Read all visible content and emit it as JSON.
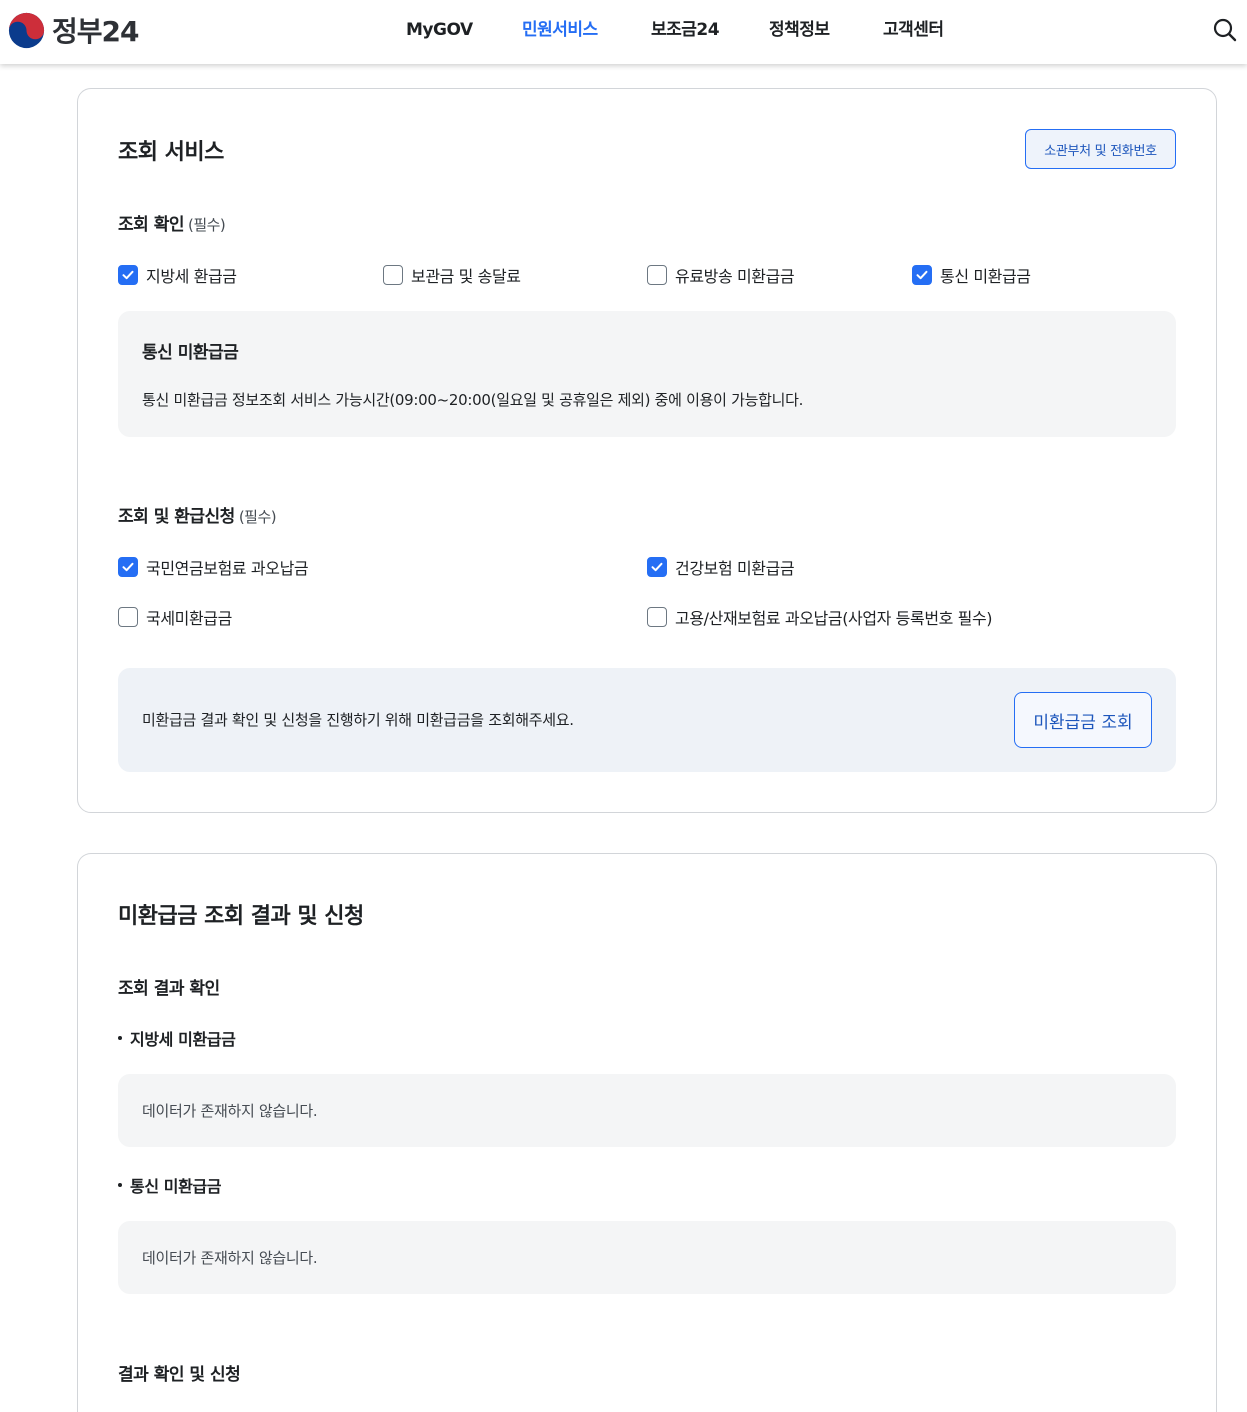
{
  "header": {
    "logo_text": "정부24",
    "nav": [
      {
        "label": "MyGOV",
        "active": false
      },
      {
        "label": "민원서비스",
        "active": true
      },
      {
        "label": "보조금24",
        "active": false
      },
      {
        "label": "정책정보",
        "active": false
      },
      {
        "label": "고객센터",
        "active": false
      }
    ],
    "search_icon": "search-icon"
  },
  "lookup_service": {
    "title": "조회 서비스",
    "contact_button": "소관부처 및 전화번호",
    "check_section": {
      "title": "조회 확인",
      "required": "(필수)",
      "options": [
        {
          "label": "지방세 환급금",
          "checked": true
        },
        {
          "label": "보관금 및 송달료",
          "checked": false
        },
        {
          "label": "유료방송 미환급금",
          "checked": false
        },
        {
          "label": "통신 미환급금",
          "checked": true
        }
      ]
    },
    "telecom_info": {
      "title": "통신 미환급금",
      "text": "통신 미환급금 정보조회 서비스 가능시간(09:00~20:00(일요일 및 공휴일은 제외) 중에 이용이 가능합니다."
    },
    "refund_section": {
      "title": "조회 및 환급신청",
      "required": "(필수)",
      "options": [
        {
          "label": "국민연금보험료 과오납금",
          "checked": true
        },
        {
          "label": "건강보험 미환급금",
          "checked": true
        },
        {
          "label": "국세미환급금",
          "checked": false
        },
        {
          "label": "고용/산재보험료 과오납금(사업자 등록번호 필수)",
          "checked": false
        }
      ]
    },
    "notice": {
      "text": "미환급금 결과 확인 및 신청을 진행하기 위해 미환급금을 조회해주세요.",
      "button": "미환급금 조회"
    }
  },
  "result": {
    "title": "미환급금 조회 결과 및 신청",
    "check_title": "조회 결과 확인",
    "items": [
      {
        "title": "지방세 미환급금",
        "empty_text": "데이터가 존재하지 않습니다."
      },
      {
        "title": "통신 미환급금",
        "empty_text": "데이터가 존재하지 않습니다."
      }
    ],
    "apply_title": "결과 확인 및 신청"
  },
  "colors": {
    "primary": "#256ef4",
    "active_nav": "#256ef4",
    "border": "#d2d5d9",
    "box_bg": "#f4f5f6",
    "notice_bg": "#eef2f7"
  }
}
